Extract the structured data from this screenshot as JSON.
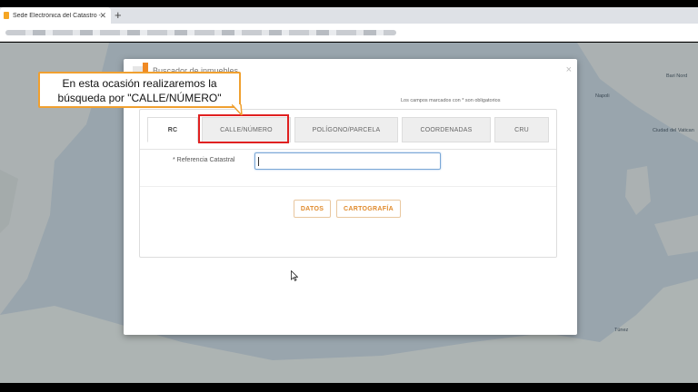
{
  "browser": {
    "tab_title": "Sede Electrónica del Catastro - P",
    "tab_close": "✕",
    "new_tab": "+"
  },
  "map": {
    "labels": {
      "bari": "Bari Nord",
      "napoli": "Napoli",
      "vaticano": "Ciudad del Vatican",
      "tunis": "Túnez"
    }
  },
  "modal": {
    "title": "Buscador de inmuebles",
    "close": "×",
    "required_note": "Los campos marcados con * son obligatorios",
    "tabs": [
      {
        "label": "RC",
        "active": true
      },
      {
        "label": "CALLE/NÚMERO",
        "active": false
      },
      {
        "label": "POLÍGONO/PARCELA",
        "active": false
      },
      {
        "label": "COORDENADAS",
        "active": false
      },
      {
        "label": "CRU",
        "active": false
      }
    ],
    "field": {
      "label": "* Referencia Catastral",
      "value": ""
    },
    "buttons": {
      "datos": "DATOS",
      "cartografia": "CARTOGRAFÍA"
    }
  },
  "callout": {
    "line1": "En esta ocasión realizaremos la",
    "line2": "búsqueda por \"CALLE/NÚMERO\""
  },
  "colors": {
    "accent": "#f08a24",
    "highlight": "#e02020",
    "callout_border": "#f0a030",
    "map_sea": "#b8c4cc",
    "map_land": "#d7dbd9"
  }
}
